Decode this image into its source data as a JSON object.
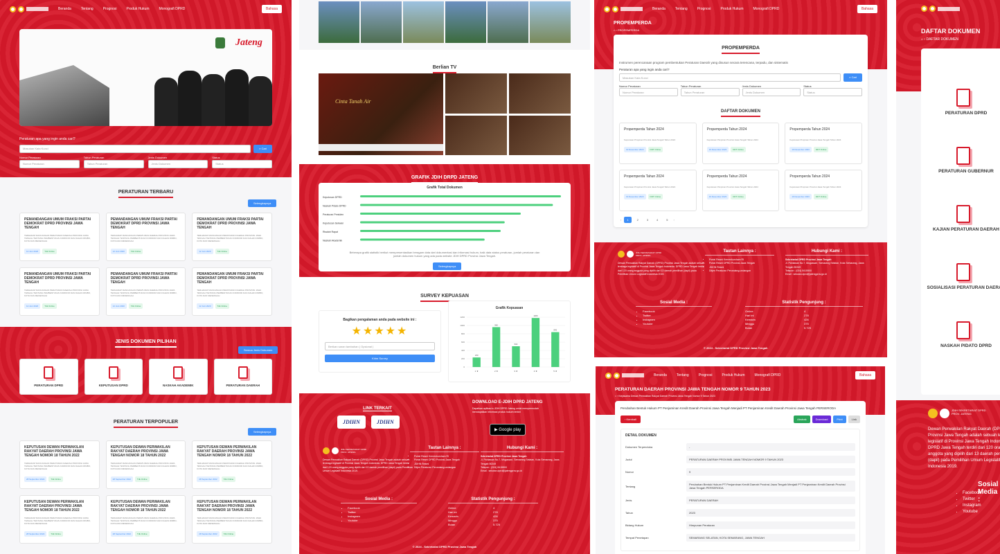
{
  "nav": {
    "items": [
      "Beranda",
      "Tentang",
      "Prognosi",
      "Produk Hukum",
      "Monografi DPRD"
    ],
    "bahasa": "Bahasa"
  },
  "panel1": {
    "search_label": "Peraturan apa yang ingin anda cari?",
    "search_placeholder": "Masukan Kata Kunci",
    "search_btn": "Cari",
    "filters": [
      {
        "label": "Nomor Peraturan",
        "ph": "Nomor Peraturan"
      },
      {
        "label": "Tahun Peraturan",
        "ph": "Tahun Peraturan"
      },
      {
        "label": "Jenis Dokumen",
        "ph": "Jenis Dokumen"
      },
      {
        "label": "Status",
        "ph": "Status"
      }
    ],
    "latest_title": "PERATURAN TERBARU",
    "see_all": "Selengkapnya",
    "latest_card": {
      "title": "PEMANDANGAN UMUM FRAKSI PARTAI DEMOKRAT DPRD PROVINSI JAWA TENGAH",
      "desc": "TERHADAP RANCANGAN PERATURAN DAERAH PROVINSI JAWA TENGAH TENTANG PEMBENTUKAN KORIDOR DAN DAHAN RIMBO, KOTA DAN MENENGAH",
      "date": "12 Juni 2020",
      "status": "Tdk Online"
    },
    "types_title": "JENIS DOKUMEN PILIHAN",
    "types_btn": "Semua Jenis Dokumen",
    "types": [
      "PERATURAN DPRD",
      "KEPUTUSAN DPRD",
      "NASKAH AKADEMIK",
      "PERATURAN DAERAH"
    ],
    "popular_title": "PERATURAN TERPOPULER",
    "popular_card": {
      "title": "KEPUTUSAN DEWAN PERWAKILAN RAKYAT DAERAH PROVINSI JAWA TENGAH NOMOR 18 TAHUN 2022",
      "desc": "TERHADAP RANCANGAN PERATURAN DAERAH PROVINSI JAWA TENGAH TENTANG PEMBENTUKAN KORIDOR DAN DAHAN RIMBO, KOTA DAN MENENGAH",
      "date": "28 September 2022",
      "status": "Tdk Online"
    }
  },
  "panel2": {
    "tv_title": "Berlian TV",
    "tv_caption": "Cinta Tanah Air",
    "chart_section": "GRAFIK JDIH DRPD JATENG",
    "chart_title": "Grafik Total Dokumen",
    "chart_desc": "Beberapa grafik statistik berikut mempresentasikan beragam data dari dokumentasi dan informasi hukum, baik data status peraturan, jumlah peraturan dan jumlah dokumen hukum yang ada pada website JDIH DPRD Provinsi Jawa Tengah.",
    "chart_btn": "Selengkapnya",
    "survey_title": "SURVEY KEPUASAN",
    "survey_q": "Bagikan pengalaman anda pada website ini :",
    "survey_ph": "Berikan saran tambahan ( Opsional )",
    "survey_btn": "Kirim Survey",
    "survey_chart_title": "Grafik Kepuasan",
    "link_title": "LINK TERKAIT",
    "download_title": "DOWNLOAD E-JDIH DPRD JATENG",
    "download_desc": "Dapatkan aplikasi e-JDIH DPRD Jateng untuk mempermudah mendapatkan informasi produk hukum terkini",
    "gplay": "Google play",
    "jdihn": "JDIHN"
  },
  "footer": {
    "org": "Dewan Perwakilan Rakyat Daerah (DPRD) Provinsi Jawa Tengah adalah sebuah lembaga legislatif di Provinsi Jawa Tengah Indonesia. DPRD Jawa Tengah terdiri dari 120 orang anggota yang dipilih dari 13 daerah pemilihan (dapil) pada Pemilihan Umum Legislatif Indonesia 2019.",
    "links_title": "Tautan Lainnya :",
    "links": [
      "Portal Resmi Kemenkumham RI",
      "Portal Resmi DPRD Provinsi Jawa Tengah",
      "JDIHN Resmi",
      "Ditjen Peraturan Perundang-undangan"
    ],
    "contact_title": "Hubungi Kami :",
    "contact": [
      "Sekretariat DPRD Provinsi Jawa Tengah",
      "Jl. Pahlawan No.7, Mugassari, Semarang Selatan, Kota Semarang, Jawa Tengah 50249",
      "Telepon : (024) 8415500",
      "Email : sekwan.dprd@jatengprov.go.id"
    ],
    "social_title": "Sosial Media :",
    "social": [
      "Facebook",
      "Twitter",
      "Instagram",
      "Youtube"
    ],
    "stats_title": "Statistik Pengunjung :",
    "stats": [
      [
        "Online",
        "4"
      ],
      [
        "Hari ini",
        "278"
      ],
      [
        "Kemarin",
        "426"
      ],
      [
        "Minggu",
        "375"
      ],
      [
        "Bulan",
        "5.725"
      ]
    ],
    "copyright": "© 2024 - Sekretariat DPRD Provinsi Jawa Tengah",
    "brand": "JDIH SEKRETARIAT DPRD PROV. JATENG"
  },
  "panel3": {
    "page": "PROPEMPERDA",
    "crumb": "PROPEMPERDA",
    "box_title": "PROPEMPERDA",
    "intro": "Instrumen perencanaan program pembentukan Peraturan Daerah yang disusun secara terencana, terpadu, dan sistematis",
    "docs_title": "DAFTAR DOKUMEN",
    "card": {
      "title": "Propemperda Tahun 2024",
      "desc": "Keputusan Pimpinan Provinsi Jawa Tengah Tahun 2024",
      "date": "19 Desember 2023",
      "status": "DDT Online"
    },
    "pages": [
      "1",
      "2",
      "3",
      "4",
      "5"
    ]
  },
  "panel4": {
    "page": "DAFTAR DOKUMEN",
    "crumb": "DAFTAR DOKUMEN",
    "items": [
      "PERATURAN DPRD",
      "PERATURAN GUBERNUR",
      "KAJIAN PERATURAN DAERAH",
      "SOSIALISASI PERATURAN DAERAH",
      "NASKAH PIDATO DPRD"
    ]
  },
  "panel5": {
    "title": "PERATURAN DAERAH PROVINSI JAWA TENGAH NOMOR 9 TAHUN 2023",
    "crumb": "Kerjasama Dewan Perwakilan Rakyat Daerah Provinsi Jawa Tengah Nomor 9 Tahun 2023",
    "desc": "Perubahan Bentuk Hukum PT Penjaminan Kredit Daerah Provinsi Jawa Tengah Menjadi PT Penjaminan Kredit Daerah Provinsi Jawa Tengah PERSERODA",
    "back": "Kembali",
    "actions": [
      "Abstrak",
      "Download",
      "Print",
      "Link"
    ],
    "detail_title": "DETAIL DOKUMEN",
    "rows": [
      [
        "Dokumen Terpenduka",
        "-"
      ],
      [
        "Judul",
        "PERATURAN DAERAH PROVINSI JAWA TENGAH NOMOR 9 TAHUN 2023"
      ],
      [
        "Nomor",
        "9"
      ],
      [
        "Tentang",
        "Perubahan Bentuk Hukum PT Penjaminan Kredit Daerah Provinsi Jawa Tengah Menjadi PT Penjaminan Kredit Daerah Provinsi Jawa Tengah PERSERODA"
      ],
      [
        "Jenis",
        "PERATURAN DAERAH"
      ],
      [
        "Tahun",
        "2023"
      ],
      [
        "Bidang Hukum",
        "Himpunan Peraturan"
      ],
      [
        "Tempat Penetapan",
        "SEMARANG SELATAN, KOTA SEMARANG, JAWA TENGAH"
      ]
    ]
  },
  "bar_chart": {
    "type": "bar",
    "categories": [
      "Keputusan DPRD",
      "Naskah Pidato DPRD",
      "Peraturan Presiden",
      "Keputusan Sekwan",
      "Risalah Rapat",
      "Naskah Akademik"
    ],
    "values": [
      100,
      96,
      80,
      72,
      70,
      62
    ],
    "color": "#4cd07d"
  },
  "survey_chart": {
    "type": "bar",
    "categories": [
      "1 ★",
      "2 ★",
      "3 ★",
      "4 ★",
      "5 ★"
    ],
    "values": [
      230,
      960,
      500,
      1180,
      840
    ],
    "ylim": [
      0,
      1200
    ],
    "yticks": [
      0,
      200,
      400,
      600,
      800,
      1000,
      1200
    ],
    "color": "#4cd07d"
  }
}
